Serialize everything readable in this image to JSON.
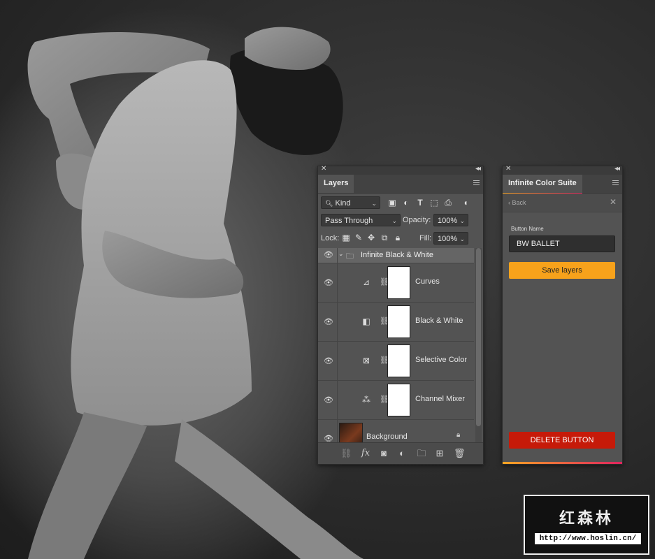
{
  "layers_panel": {
    "tab_label": "Layers",
    "filter_kind": "Kind",
    "blend_mode": "Pass Through",
    "opacity_label": "Opacity:",
    "opacity_value": "100%",
    "lock_label": "Lock:",
    "fill_label": "Fill:",
    "fill_value": "100%",
    "group_name": "Infinite Black & White",
    "layers": [
      {
        "name": "Curves",
        "icon": "curves-icon"
      },
      {
        "name": "Black & White",
        "icon": "black-white-icon"
      },
      {
        "name": "Selective Color",
        "icon": "selective-color-icon"
      },
      {
        "name": "Channel Mixer",
        "icon": "channel-mixer-icon"
      }
    ],
    "background_layer": "Background"
  },
  "suite_panel": {
    "tab_label": "Infinite Color Suite",
    "back_label": "Back",
    "field_label": "Button Name",
    "button_name_value": "BW BALLET",
    "save_label": "Save layers",
    "delete_label": "DELETE BUTTON"
  },
  "watermark": {
    "title": "红森林",
    "url": "http://www.hoslin.cn/"
  },
  "colors": {
    "save": "#f7a21b",
    "delete": "#c61a09",
    "accent_gradient_start": "#f6a623",
    "accent_gradient_end": "#e0245e"
  }
}
